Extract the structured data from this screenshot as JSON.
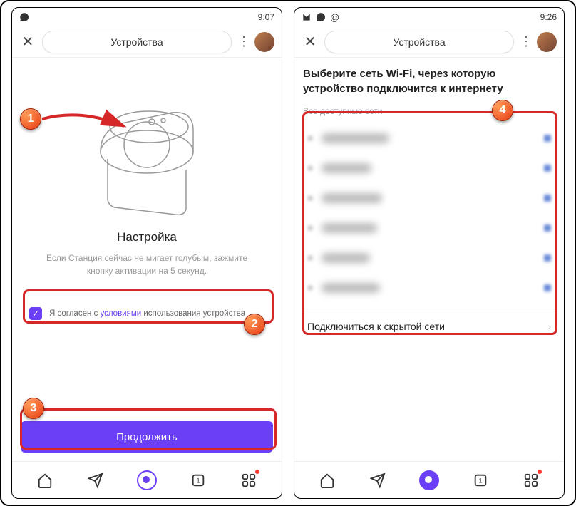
{
  "left": {
    "status": {
      "time": "9:07",
      "icons": [
        "whatsapp"
      ]
    },
    "header": {
      "title": "Устройства"
    },
    "setup": {
      "title": "Настройка",
      "subtitle": "Если Станция сейчас не мигает голубым, зажмите кнопку активации на 5 секунд."
    },
    "terms": {
      "prefix": "Я согласен с ",
      "link": "условиями",
      "suffix": " использования устройства"
    },
    "continue_label": "Продолжить"
  },
  "right": {
    "status": {
      "time": "9:26",
      "icons": [
        "mail",
        "whatsapp",
        "at"
      ]
    },
    "header": {
      "title": "Устройства"
    },
    "wifi": {
      "title": "Выберите сеть Wi-Fi, через которую устройство подключится к интернету",
      "all_networks_label": "Все доступные сети",
      "networks": [
        {
          "name": "████████",
          "secured": true
        },
        {
          "name": "██████",
          "secured": true
        },
        {
          "name": "████████",
          "secured": true
        },
        {
          "name": "██████",
          "secured": true
        },
        {
          "name": "██████",
          "secured": true
        },
        {
          "name": "████████",
          "secured": true
        }
      ],
      "hidden_network_label": "Подключиться к скрытой сети"
    }
  },
  "callouts": {
    "c1": "1",
    "c2": "2",
    "c3": "3",
    "c4": "4"
  }
}
